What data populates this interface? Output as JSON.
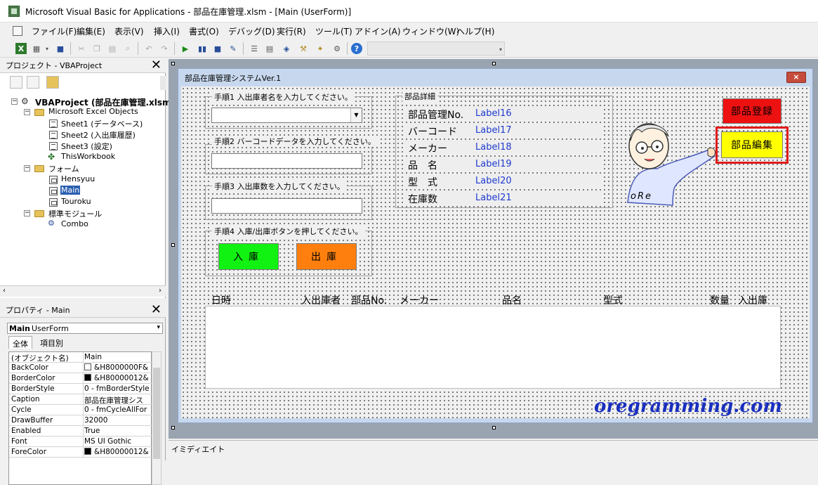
{
  "window": {
    "title": "Microsoft Visual Basic for Applications - 部品在庫管理.xlsm - [Main (UserForm)]"
  },
  "menu": [
    "ファイル(F)",
    "編集(E)",
    "表示(V)",
    "挿入(I)",
    "書式(O)",
    "デバッグ(D)",
    "実行(R)",
    "ツール(T)",
    "アドイン(A)",
    "ウィンドウ(W)",
    "ヘルプ(H)"
  ],
  "project": {
    "title": "プロジェクト - VBAProject",
    "root": "VBAProject (部品在庫管理.xlsm",
    "excel_objects": "Microsoft Excel Objects",
    "sheets": [
      "Sheet1 (データベース)",
      "Sheet2 (入出庫履歴)",
      "Sheet3 (設定)",
      "ThisWorkbook"
    ],
    "forms_folder": "フォーム",
    "forms": [
      "Hensyuu",
      "Main",
      "Touroku"
    ],
    "modules_folder": "標準モジュール",
    "modules": [
      "Combo"
    ]
  },
  "properties": {
    "title": "プロパティ - Main",
    "object_name": "Main",
    "object_type": "UserForm",
    "tabs": [
      "全体",
      "項目別"
    ],
    "rows": [
      {
        "name": "(オブジェクト名)",
        "value": "Main"
      },
      {
        "name": "BackColor",
        "value": "&H8000000F&",
        "swatch": "#ffffff"
      },
      {
        "name": "BorderColor",
        "value": "&H80000012&",
        "swatch": "#000000"
      },
      {
        "name": "BorderStyle",
        "value": "0 - fmBorderStyle"
      },
      {
        "name": "Caption",
        "value": "部品在庫管理シス"
      },
      {
        "name": "Cycle",
        "value": "0 - fmCycleAllFor"
      },
      {
        "name": "DrawBuffer",
        "value": "32000"
      },
      {
        "name": "Enabled",
        "value": "True"
      },
      {
        "name": "Font",
        "value": "MS UI Gothic"
      },
      {
        "name": "ForeColor",
        "value": "&H80000012&",
        "swatch": "#000000"
      }
    ]
  },
  "form": {
    "caption": "部品在庫管理システムVer.1",
    "close": "×",
    "step1": "手順1 入出庫者名を入力してください。",
    "step2": "手順2 バーコードデータを入力してください。",
    "step3": "手順3 入出庫数を入力してください。",
    "step4": "手順4 入庫/出庫ボタンを押してください。",
    "in_button": "入庫",
    "out_button": "出庫",
    "detail_caption": "部品詳細",
    "details": [
      {
        "label": "部品管理No.",
        "value": "Label16"
      },
      {
        "label": "バーコード",
        "value": "Label17"
      },
      {
        "label": "メーカー",
        "value": "Label18"
      },
      {
        "label": "品　名",
        "value": "Label19"
      },
      {
        "label": "型　式",
        "value": "Label20"
      },
      {
        "label": "在庫数",
        "value": "Label21"
      }
    ],
    "register_button": "部品登録",
    "edit_button": "部品編集",
    "mascot_text": "oRe",
    "list_headers": [
      "日時",
      "入出庫者",
      "部品No.",
      "メーカー",
      "品名",
      "型式",
      "数量",
      "入出庫"
    ],
    "brand": "oregramming.com"
  },
  "immediate": {
    "title": "イミディエイト"
  },
  "colors": {
    "in": "#12f212",
    "out": "#ff7f0e",
    "register": "#ee1111",
    "edit": "#ffff00",
    "edit_border": "#e11b1b",
    "label_blue": "#1f3ad0"
  }
}
